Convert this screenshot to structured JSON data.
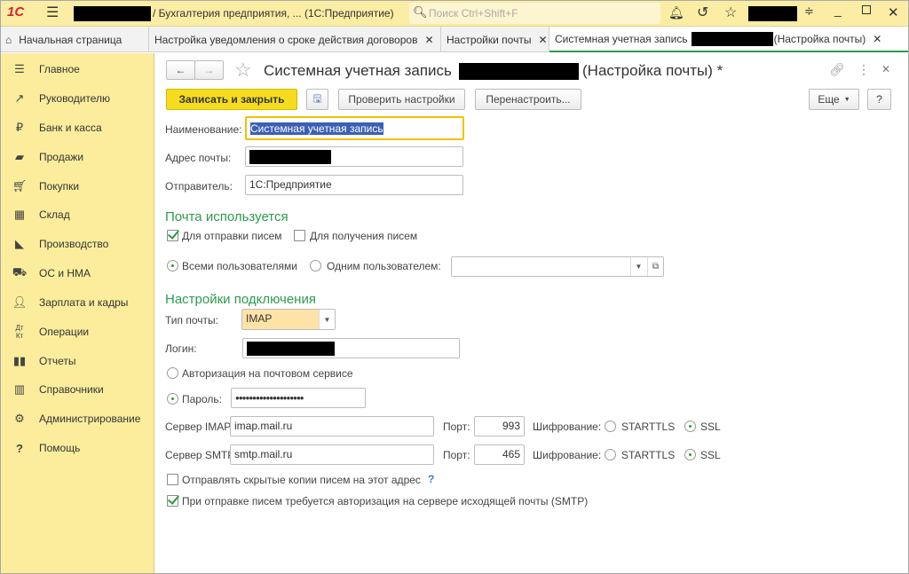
{
  "window": {
    "app_title": "/ Бухгалтерия предприятия, ...  (1С:Предприятие)",
    "search_placeholder": "Поиск Ctrl+Shift+F",
    "logo": "1С"
  },
  "tabs": [
    {
      "label": "Начальная страница"
    },
    {
      "label": "Настройка уведомления о сроке действия договоров"
    },
    {
      "label": "Настройки почты"
    },
    {
      "label": "Системная учетная запись",
      "label_suffix": "(Настройка почты)"
    }
  ],
  "sidebar": {
    "items": [
      {
        "label": "Главное",
        "icon": "menu-icon"
      },
      {
        "label": "Руководителю",
        "icon": "trend-icon"
      },
      {
        "label": "Банк и касса",
        "icon": "ruble-icon"
      },
      {
        "label": "Продажи",
        "icon": "bag-icon"
      },
      {
        "label": "Покупки",
        "icon": "cart-icon"
      },
      {
        "label": "Склад",
        "icon": "warehouse-icon"
      },
      {
        "label": "Производство",
        "icon": "factory-icon"
      },
      {
        "label": "ОС и НМА",
        "icon": "truck-icon"
      },
      {
        "label": "Зарплата и кадры",
        "icon": "person-icon"
      },
      {
        "label": "Операции",
        "icon": "dt-kt-icon"
      },
      {
        "label": "Отчеты",
        "icon": "bar-chart-icon"
      },
      {
        "label": "Справочники",
        "icon": "books-icon"
      },
      {
        "label": "Администрирование",
        "icon": "gear-icon"
      },
      {
        "label": "Помощь",
        "icon": "help-icon"
      }
    ]
  },
  "form": {
    "title": "Системная учетная запись",
    "title_suffix": "(Настройка почты) *",
    "toolbar": {
      "save_close": "Записать и закрыть",
      "check": "Проверить настройки",
      "reconfigure": "Перенастроить...",
      "more": "Еще",
      "help": "?"
    },
    "name_label": "Наименование:",
    "name_value": "Системная учетная запись",
    "email_label": "Адрес почты:",
    "sender_label": "Отправитель:",
    "sender_value": "1С:Предприятие",
    "usage_section": "Почта используется",
    "send_label": "Для отправки писем",
    "send_checked": true,
    "receive_label": "Для получения писем",
    "receive_checked": false,
    "all_users_label": "Всеми пользователями",
    "one_user_label": "Одним пользователем:",
    "conn_section": "Настройки подключения",
    "mail_type_label": "Тип почты:",
    "mail_type_value": "IMAP",
    "login_label": "Логин:",
    "oauth_label": "Авторизация на почтовом сервисе",
    "password_label": "Пароль:",
    "password_value": "●●●●●●●●●●●●●●●●●●●●",
    "imap_label": "Сервер IMAP:",
    "imap_value": "imap.mail.ru",
    "imap_port": "993",
    "smtp_label": "Сервер SMTP:",
    "smtp_value": "smtp.mail.ru",
    "smtp_port": "465",
    "port_label": "Порт:",
    "enc_label": "Шифрование:",
    "starttls": "STARTTLS",
    "ssl": "SSL",
    "bcc_label": "Отправлять скрытые копии писем на этот адрес",
    "bcc_help": "?",
    "smtp_auth_label": "При отправке писем требуется авторизация на сервере исходящей почты (SMTP)"
  }
}
